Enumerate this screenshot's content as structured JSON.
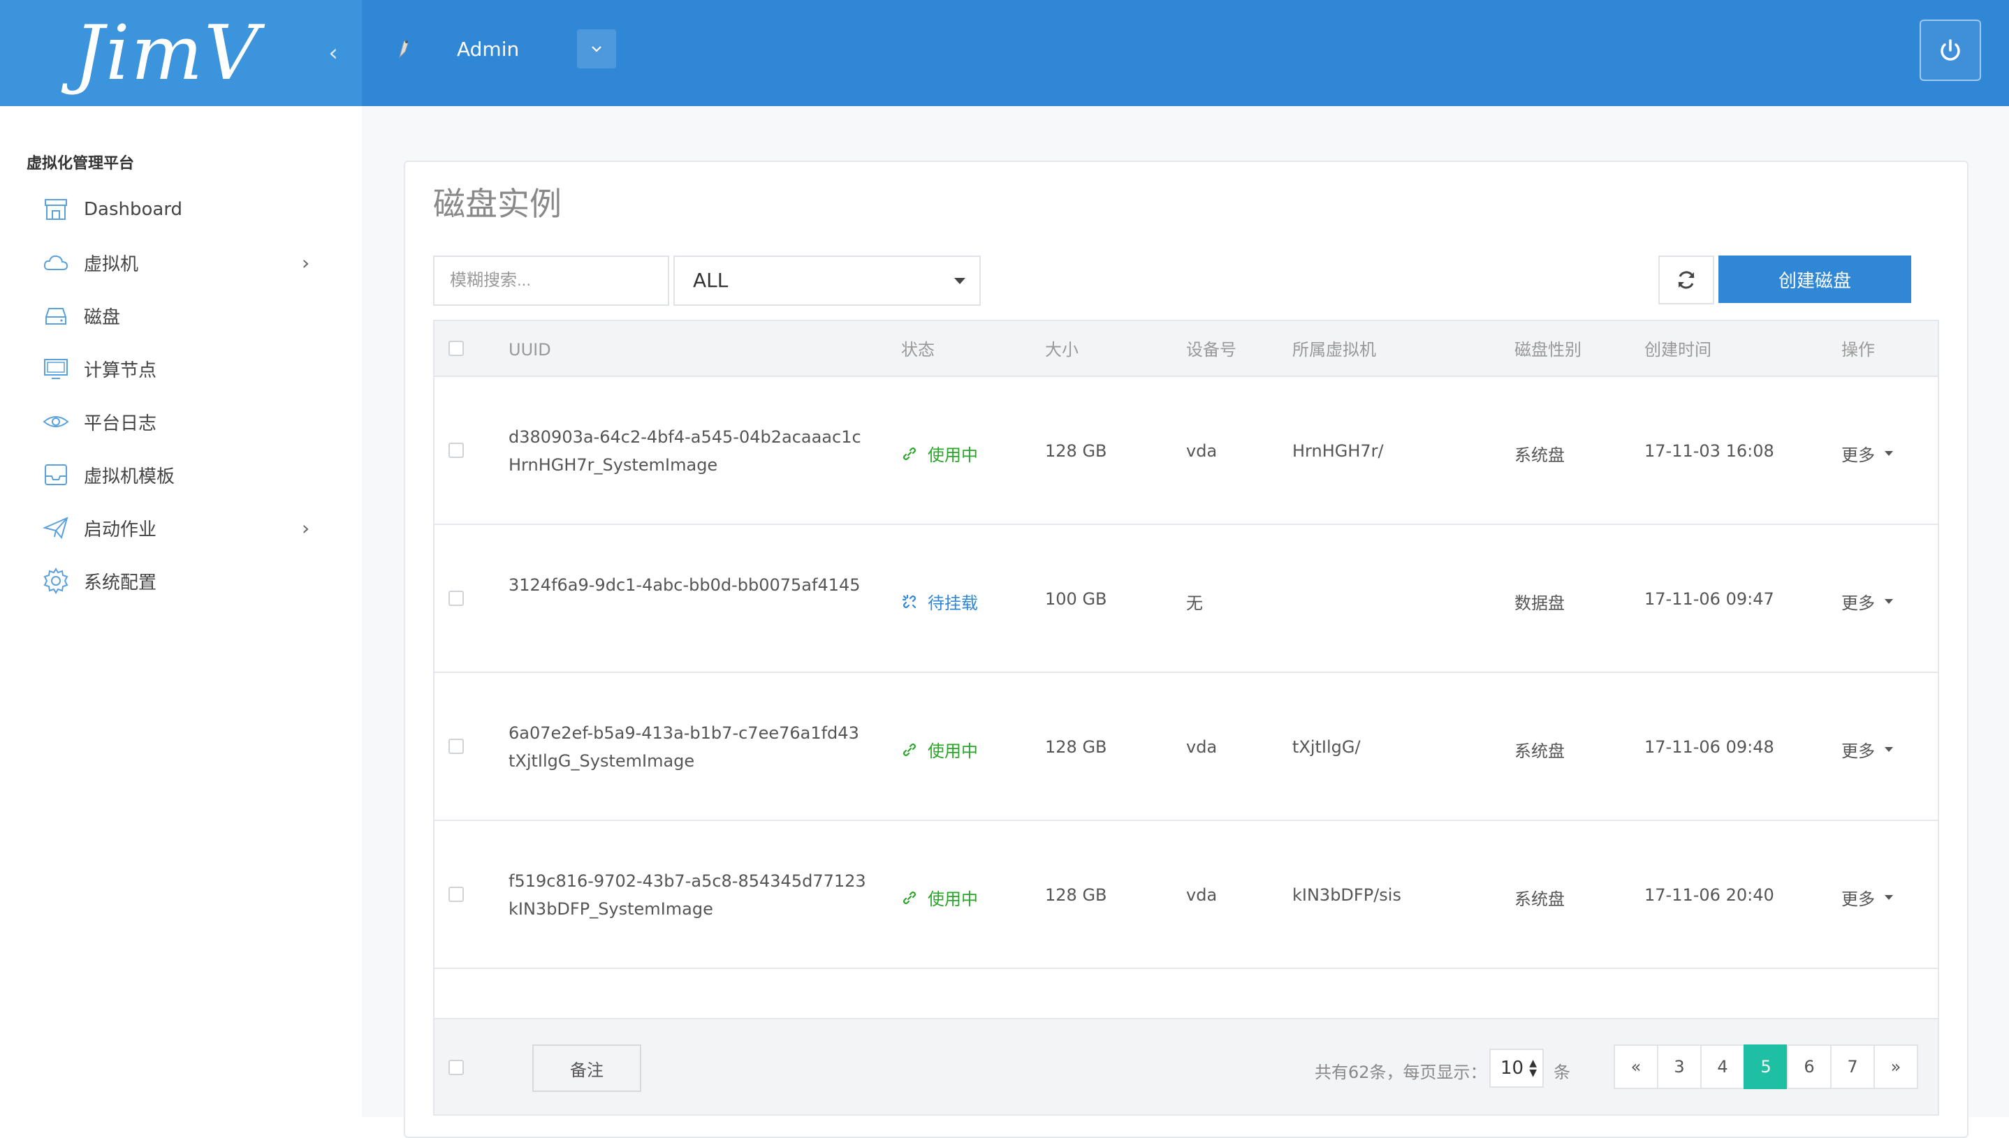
{
  "header": {
    "logo_text": "JimV",
    "user_name": "Admin"
  },
  "sidebar": {
    "title": "虚拟化管理平台",
    "items": [
      {
        "label": "Dashboard",
        "icon": "store-icon",
        "has_arrow": false
      },
      {
        "label": "虚拟机",
        "icon": "cloud-icon",
        "has_arrow": true
      },
      {
        "label": "磁盘",
        "icon": "hard-drive-icon",
        "has_arrow": false
      },
      {
        "label": "计算节点",
        "icon": "monitor-icon",
        "has_arrow": false
      },
      {
        "label": "平台日志",
        "icon": "eye-icon",
        "has_arrow": false
      },
      {
        "label": "虚拟机模板",
        "icon": "inbox-icon",
        "has_arrow": false
      },
      {
        "label": "启动作业",
        "icon": "paper-plane-icon",
        "has_arrow": true
      },
      {
        "label": "系统配置",
        "icon": "gear-icon",
        "has_arrow": false
      }
    ]
  },
  "main": {
    "title": "磁盘实例",
    "search_placeholder": "模糊搜索...",
    "filter_value": "ALL",
    "create_button": "创建磁盘"
  },
  "table": {
    "headers": [
      "UUID",
      "状态",
      "大小",
      "设备号",
      "所属虚拟机",
      "磁盘性别",
      "创建时间",
      "操作"
    ],
    "rows": [
      {
        "uuid": "d380903a-64c2-4bf4-a545-04b2acaaac1c",
        "label": "HrnHGH7r_SystemImage",
        "status": "使用中",
        "status_kind": "in-use",
        "size": "128 GB",
        "device": "vda",
        "vm": "HrnHGH7r/",
        "disk_type": "系统盘",
        "created": "17-11-03 16:08",
        "action": "更多"
      },
      {
        "uuid": "3124f6a9-9dc1-4abc-bb0d-bb0075af4145",
        "label": "",
        "status": "待挂载",
        "status_kind": "pending",
        "size": "100 GB",
        "device": "无",
        "vm": "",
        "disk_type": "数据盘",
        "created": "17-11-06 09:47",
        "action": "更多"
      },
      {
        "uuid": "6a07e2ef-b5a9-413a-b1b7-c7ee76a1fd43",
        "label": "tXjtIlgG_SystemImage",
        "status": "使用中",
        "status_kind": "in-use",
        "size": "128 GB",
        "device": "vda",
        "vm": "tXjtIlgG/",
        "disk_type": "系统盘",
        "created": "17-11-06 09:48",
        "action": "更多"
      },
      {
        "uuid": "f519c816-9702-43b7-a5c8-854345d77123",
        "label": "kIN3bDFP_SystemImage",
        "status": "使用中",
        "status_kind": "in-use",
        "size": "128 GB",
        "device": "vda",
        "vm": "kIN3bDFP/sis",
        "disk_type": "系统盘",
        "created": "17-11-06 20:40",
        "action": "更多"
      }
    ]
  },
  "footer": {
    "note_button": "备注",
    "total_text": "共有62条，每页显示：",
    "page_size": "10",
    "per_unit": "条",
    "pages": [
      "«",
      "3",
      "4",
      "5",
      "6",
      "7",
      "»"
    ],
    "current_page": "5"
  },
  "colors": {
    "header_bg": "#2f87d6",
    "brand_bg": "#3c94dc",
    "status_in_use": "#2aa52a",
    "status_pending": "#2f87d6",
    "pager_active": "#1fbfa3"
  }
}
